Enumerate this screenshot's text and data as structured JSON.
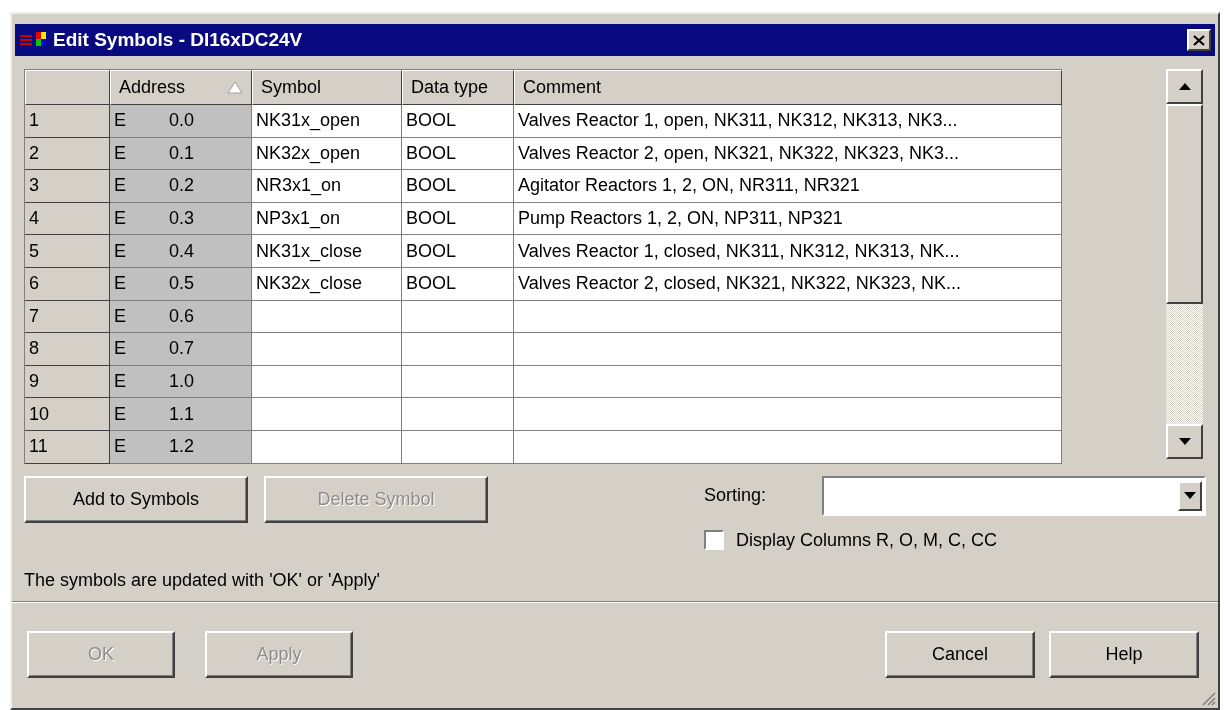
{
  "window": {
    "title": "Edit Symbols - DI16xDC24V"
  },
  "table": {
    "columns": [
      {
        "sorted": false
      },
      {
        "label": "Address",
        "sorted": true
      },
      {
        "label": "Symbol",
        "sorted": false
      },
      {
        "label": "Data type",
        "sorted": false
      },
      {
        "label": "Comment",
        "sorted": false
      }
    ],
    "rows": [
      {
        "number": "1",
        "area": "E",
        "address": "0.0",
        "symbol": "NK31x_open",
        "data_type": "BOOL",
        "comment": "Valves Reactor 1, open, NK311, NK312, NK313, NK3..."
      },
      {
        "number": "2",
        "area": "E",
        "address": "0.1",
        "symbol": "NK32x_open",
        "data_type": "BOOL",
        "comment": "Valves Reactor 2, open, NK321, NK322, NK323, NK3..."
      },
      {
        "number": "3",
        "area": "E",
        "address": "0.2",
        "symbol": "NR3x1_on",
        "data_type": "BOOL",
        "comment": "Agitator Reactors 1, 2, ON, NR311, NR321"
      },
      {
        "number": "4",
        "area": "E",
        "address": "0.3",
        "symbol": "NP3x1_on",
        "data_type": "BOOL",
        "comment": "Pump Reactors 1, 2, ON, NP311, NP321"
      },
      {
        "number": "5",
        "area": "E",
        "address": "0.4",
        "symbol": "NK31x_close",
        "data_type": "BOOL",
        "comment": "Valves Reactor 1, closed, NK311, NK312, NK313, NK..."
      },
      {
        "number": "6",
        "area": "E",
        "address": "0.5",
        "symbol": "NK32x_close",
        "data_type": "BOOL",
        "comment": "Valves Reactor 2, closed, NK321, NK322, NK323, NK..."
      },
      {
        "number": "7",
        "area": "E",
        "address": "0.6"
      },
      {
        "number": "8",
        "area": "E",
        "address": "0.7"
      },
      {
        "number": "9",
        "area": "E",
        "address": "1.0"
      },
      {
        "number": "10",
        "area": "E",
        "address": "1.1"
      },
      {
        "number": "11",
        "area": "E",
        "address": "1.2"
      }
    ]
  },
  "table_buttons": [
    {
      "label": "Add to Symbols",
      "disabled": false
    },
    {
      "label": "Delete Symbol",
      "disabled": true
    }
  ],
  "sorting": {
    "label": "Sorting:"
  },
  "display_columns": {
    "label": "Display Columns R, O, M, C, CC",
    "checked": false
  },
  "note": "The symbols are updated with 'OK' or  'Apply'",
  "footer_buttons": [
    {
      "label": "OK",
      "disabled": true
    },
    {
      "label": "Apply",
      "disabled": true
    },
    {
      "label": "Cancel",
      "disabled": false
    },
    {
      "label": "Help",
      "disabled": false
    }
  ]
}
